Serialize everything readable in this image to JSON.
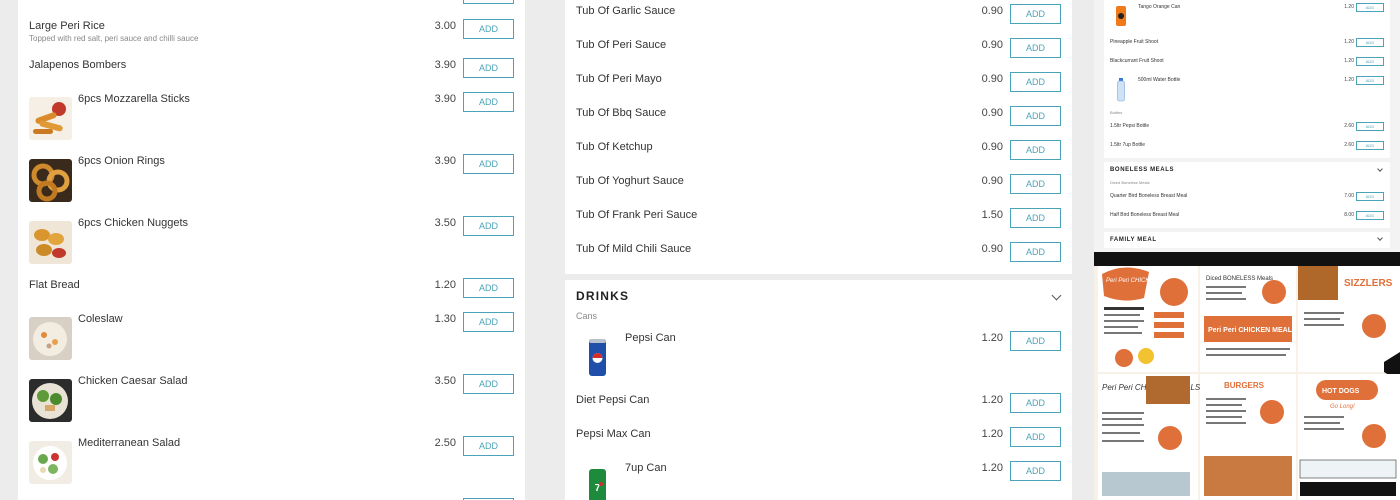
{
  "left_panel": {
    "items": [
      {
        "name": "Large Peri Rice",
        "desc": "Topped with red salt, peri sauce and chilli sauce",
        "price": "3.00",
        "add": "ADD"
      },
      {
        "name": "Jalapenos Bombers",
        "price": "3.90",
        "add": "ADD"
      },
      {
        "name": "6pcs Mozzarella Sticks",
        "price": "3.90",
        "add": "ADD"
      },
      {
        "name": "6pcs Onion Rings",
        "price": "3.90",
        "add": "ADD"
      },
      {
        "name": "6pcs Chicken Nuggets",
        "price": "3.50",
        "add": "ADD"
      },
      {
        "name": "Flat Bread",
        "price": "1.20",
        "add": "ADD"
      },
      {
        "name": "Coleslaw",
        "price": "1.30",
        "add": "ADD"
      },
      {
        "name": "Chicken Caesar Salad",
        "price": "3.50",
        "add": "ADD"
      },
      {
        "name": "Mediterranean Salad",
        "price": "2.50",
        "add": "ADD"
      }
    ]
  },
  "sauces_panel": {
    "items": [
      {
        "name": "Tub Of Garlic Sauce",
        "price": "0.90",
        "add": "ADD"
      },
      {
        "name": "Tub Of Peri Sauce",
        "price": "0.90",
        "add": "ADD"
      },
      {
        "name": "Tub Of Peri Mayo",
        "price": "0.90",
        "add": "ADD"
      },
      {
        "name": "Tub Of Bbq Sauce",
        "price": "0.90",
        "add": "ADD"
      },
      {
        "name": "Tub Of Ketchup",
        "price": "0.90",
        "add": "ADD"
      },
      {
        "name": "Tub Of Yoghurt Sauce",
        "price": "0.90",
        "add": "ADD"
      },
      {
        "name": "Tub Of Frank Peri Sauce",
        "price": "1.50",
        "add": "ADD"
      },
      {
        "name": "Tub Of Mild Chili Sauce",
        "price": "0.90",
        "add": "ADD"
      }
    ]
  },
  "drinks_panel": {
    "title": "DRINKS",
    "subcategory": "Cans",
    "items": [
      {
        "name": "Pepsi Can",
        "price": "1.20",
        "add": "ADD"
      },
      {
        "name": "Diet Pepsi Can",
        "price": "1.20",
        "add": "ADD"
      },
      {
        "name": "Pepsi Max Can",
        "price": "1.20",
        "add": "ADD"
      },
      {
        "name": "7up Can",
        "price": "1.20",
        "add": "ADD"
      }
    ]
  },
  "preview_strip": {
    "rows": [
      {
        "name": "Tango Orange Can",
        "price": "1.20",
        "add": "ADD"
      },
      {
        "name": "Pineapple Fruit Shoot",
        "price": "1.20",
        "add": "ADD"
      },
      {
        "name": "Blackcurrant Fruit Shoot",
        "price": "1.20",
        "add": "ADD"
      },
      {
        "name": "500ml Water Bottle",
        "price": "1.20",
        "add": "ADD"
      },
      {
        "name": "1.5ltr Pepsi Bottle",
        "price": "2.60",
        "add": "ADD"
      },
      {
        "name": "1.5ltr 7up Bottle",
        "price": "2.60",
        "add": "ADD"
      },
      {
        "name": "Quarter Bird Boneless Breast Meal",
        "price": "7.00",
        "add": "ADD"
      },
      {
        "name": "Half Bird Boneless Breast Meal",
        "price": "8.00",
        "add": "ADD"
      }
    ],
    "bottles_sub": "Bottles",
    "boneless_title": "BONELESS MEALS",
    "boneless_sub": "Diced Boneless Meals",
    "family_title": "FAMILY MEAL"
  },
  "menu_board": {
    "peri_chicken": "Peri Peri CHICKEN",
    "diced_boneless": "Diced BONELESS Meals",
    "sizzlers": "SIZZLERS",
    "peri_meals_mid": "Peri Peri CHICKEN MEALS",
    "peri_meals_left": "Peri Peri CHICKEN MEALS",
    "burgers": "BURGERS",
    "hot_dogs": "HOT DOGS",
    "go_long": "Go Long!"
  },
  "colors": {
    "accent": "#4aa3b8",
    "board_orange": "#e0703a"
  }
}
